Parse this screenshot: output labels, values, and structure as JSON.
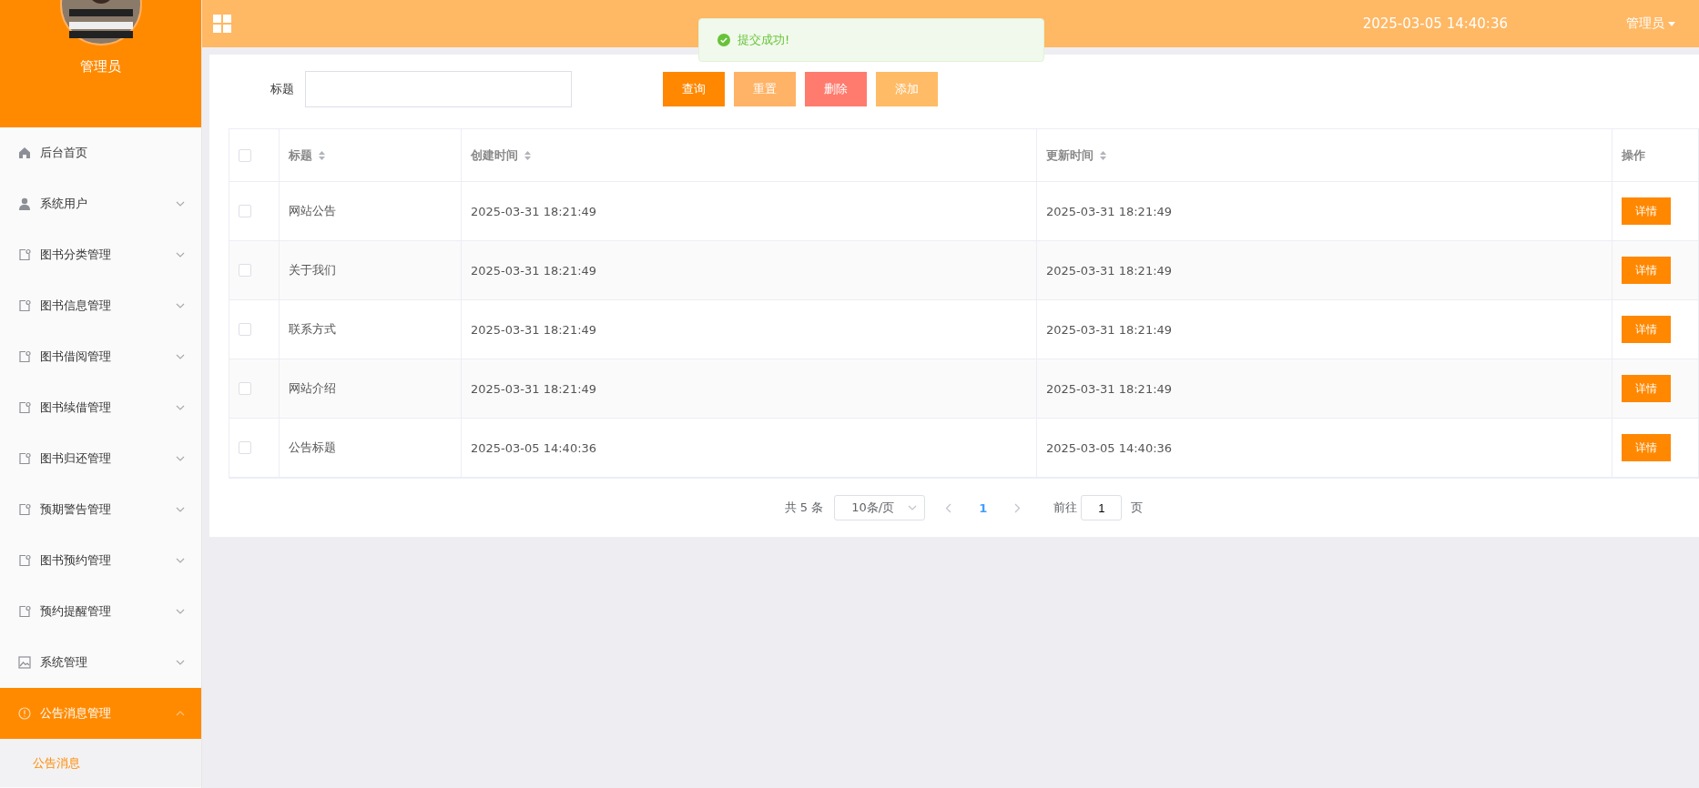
{
  "sidebar": {
    "user_name": "管理员",
    "items": [
      {
        "label": "后台首页",
        "kind": "home",
        "selected": false
      },
      {
        "label": "系统用户",
        "kind": "user",
        "expanded": false,
        "selected": false
      },
      {
        "label": "图书分类管理",
        "kind": "doc",
        "expanded": false,
        "selected": false
      },
      {
        "label": "图书信息管理",
        "kind": "doc",
        "expanded": false,
        "selected": false
      },
      {
        "label": "图书借阅管理",
        "kind": "doc",
        "expanded": false,
        "selected": false
      },
      {
        "label": "图书续借管理",
        "kind": "doc",
        "expanded": false,
        "selected": false
      },
      {
        "label": "图书归还管理",
        "kind": "doc",
        "expanded": false,
        "selected": false
      },
      {
        "label": "预期警告管理",
        "kind": "doc",
        "expanded": false,
        "selected": false
      },
      {
        "label": "图书预约管理",
        "kind": "doc",
        "expanded": false,
        "selected": false
      },
      {
        "label": "预约提醒管理",
        "kind": "doc",
        "expanded": false,
        "selected": false
      },
      {
        "label": "系统管理",
        "kind": "image",
        "expanded": false,
        "selected": false
      },
      {
        "label": "公告消息管理",
        "kind": "info",
        "expanded": true,
        "selected": true,
        "children": [
          {
            "label": "公告消息",
            "selected": true
          }
        ]
      }
    ]
  },
  "topbar": {
    "datetime": "2025-03-05 14:40:36",
    "user_menu": "管理员"
  },
  "toast": {
    "message": "提交成功!"
  },
  "search": {
    "label": "标题"
  },
  "buttons": [
    {
      "label": "查询",
      "color": "#ff8800"
    },
    {
      "label": "重置",
      "color": "#ffb366"
    },
    {
      "label": "删除",
      "color": "#ff7b6e"
    },
    {
      "label": "添加",
      "color": "#ffbb66"
    }
  ],
  "table": {
    "all_checked": false,
    "columns": [
      {
        "label": "标题",
        "sortable": true
      },
      {
        "label": "创建时间",
        "sortable": true
      },
      {
        "label": "更新时间",
        "sortable": true
      },
      {
        "label": "操作",
        "sortable": false
      }
    ],
    "rows": [
      {
        "checked": false,
        "title": "网站公告",
        "created": "2025-03-31 18:21:49",
        "updated": "2025-03-31 18:21:49",
        "action": "详情"
      },
      {
        "checked": false,
        "title": "关于我们",
        "created": "2025-03-31 18:21:49",
        "updated": "2025-03-31 18:21:49",
        "action": "详情"
      },
      {
        "checked": false,
        "title": "联系方式",
        "created": "2025-03-31 18:21:49",
        "updated": "2025-03-31 18:21:49",
        "action": "详情"
      },
      {
        "checked": false,
        "title": "网站介绍",
        "created": "2025-03-31 18:21:49",
        "updated": "2025-03-31 18:21:49",
        "action": "详情"
      },
      {
        "checked": false,
        "title": "公告标题",
        "created": "2025-03-05 14:40:36",
        "updated": "2025-03-05 14:40:36",
        "action": "详情"
      }
    ]
  },
  "pagination": {
    "total": "共 5 条",
    "page_size": "10条/页",
    "pages": [
      {
        "label": "1",
        "selected": true
      }
    ],
    "goto_label": "前往",
    "goto_value": "1",
    "goto_suffix": "页"
  }
}
